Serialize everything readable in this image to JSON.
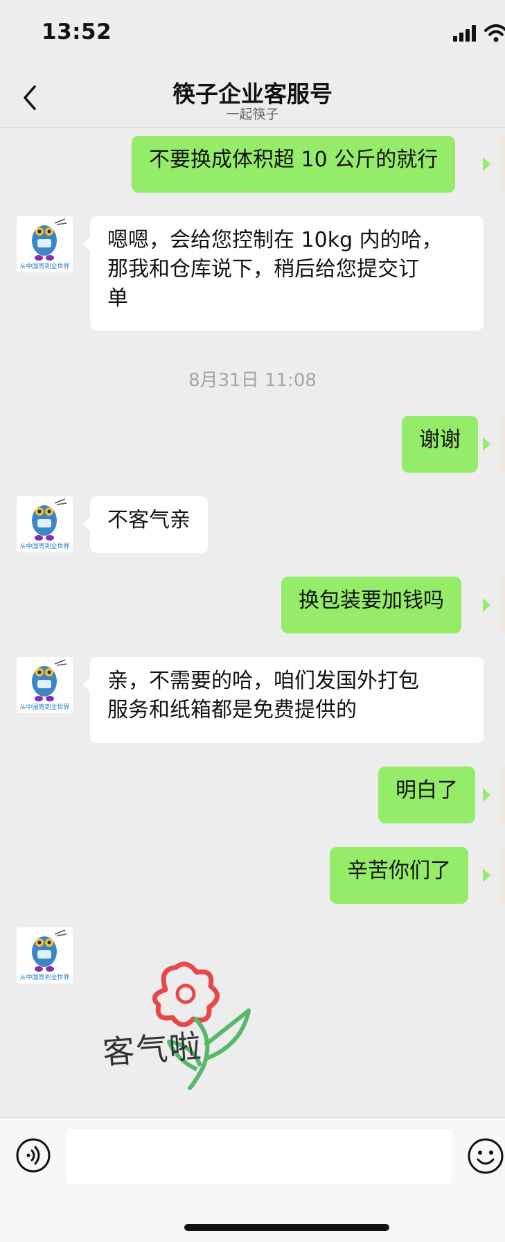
{
  "status": {
    "time": "13:52",
    "signal": "cellular-signal-icon",
    "wifi": "wifi-icon"
  },
  "header": {
    "title": "筷子企业客服号",
    "subtitle": "一起筷子",
    "back_icon": "chevron-left-icon"
  },
  "avatar": {
    "caption": "从中国寄到全世界"
  },
  "messages": [
    {
      "from": "me",
      "text": "不要换成体积超 10 公斤的就行"
    },
    {
      "from": "them",
      "lines": [
        "嗯嗯，会给您控制在 10kg 内的哈，",
        "那我和仓库说下，稍后给您提交订",
        "单"
      ]
    },
    {
      "from": "system",
      "text": "8月31日 11:08"
    },
    {
      "from": "me",
      "text": "谢谢"
    },
    {
      "from": "them",
      "text": "不客气亲"
    },
    {
      "from": "me",
      "text": "换包装要加钱吗"
    },
    {
      "from": "them",
      "lines": [
        "亲，不需要的哈，咱们发国外打包",
        "服务和纸箱都是免费提供的"
      ]
    },
    {
      "from": "me",
      "text": "明白了"
    },
    {
      "from": "me",
      "text": "辛苦你们了"
    },
    {
      "from": "them",
      "sticker": "客气啦"
    }
  ],
  "input": {
    "placeholder": "",
    "voice_icon": "voice-icon",
    "emoji_icon": "emoji-icon"
  },
  "colors": {
    "my_bubble": "#95ec69",
    "their_bubble": "#ffffff",
    "background": "#ededed"
  }
}
